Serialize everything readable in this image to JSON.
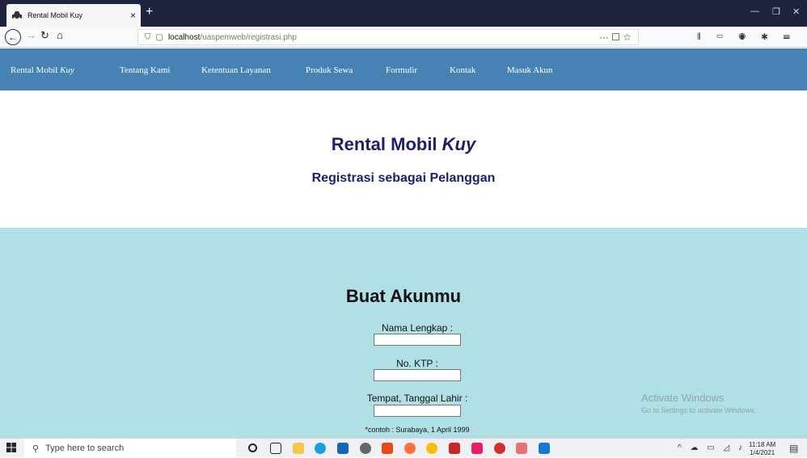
{
  "browser": {
    "tab_title": "Rental Mobil Kuy",
    "tab_close": "×",
    "new_tab": "+",
    "url_host": "localhost",
    "url_path": "/uaspemweb/registrasi.php",
    "url_actions": "··· ☐ ☆"
  },
  "nav": {
    "brand_prefix": "Rental Mobil ",
    "brand_italic": "Kuy",
    "items": [
      "Tentang Kami",
      "Ketentuan Layanan",
      "Produk Sewa",
      "Formulir",
      "Kontak",
      "Masuk Akun"
    ]
  },
  "hero": {
    "title_prefix": "Rental Mobil ",
    "title_italic": "Kuy",
    "subtitle": "Registrasi sebagai Pelanggan"
  },
  "form": {
    "title": "Buat Akunmu",
    "fields": [
      {
        "label": "Nama Lengkap :",
        "value": ""
      },
      {
        "label": "No. KTP :",
        "value": ""
      },
      {
        "label": "Tempat, Tanggal Lahir :",
        "value": ""
      }
    ],
    "example": "*contoh : Surabaya, 1 April 1999"
  },
  "watermark": {
    "line1": "Activate Windows",
    "line2": "Go to Settings to activate Windows."
  },
  "taskbar": {
    "search_placeholder": "Type here to search",
    "time": "11:18 AM",
    "date": "1/4/2021"
  },
  "colors": {
    "nav_bg": "#4682b4",
    "title_color": "#1d1f6d",
    "form_bg": "#b0dfe5"
  }
}
